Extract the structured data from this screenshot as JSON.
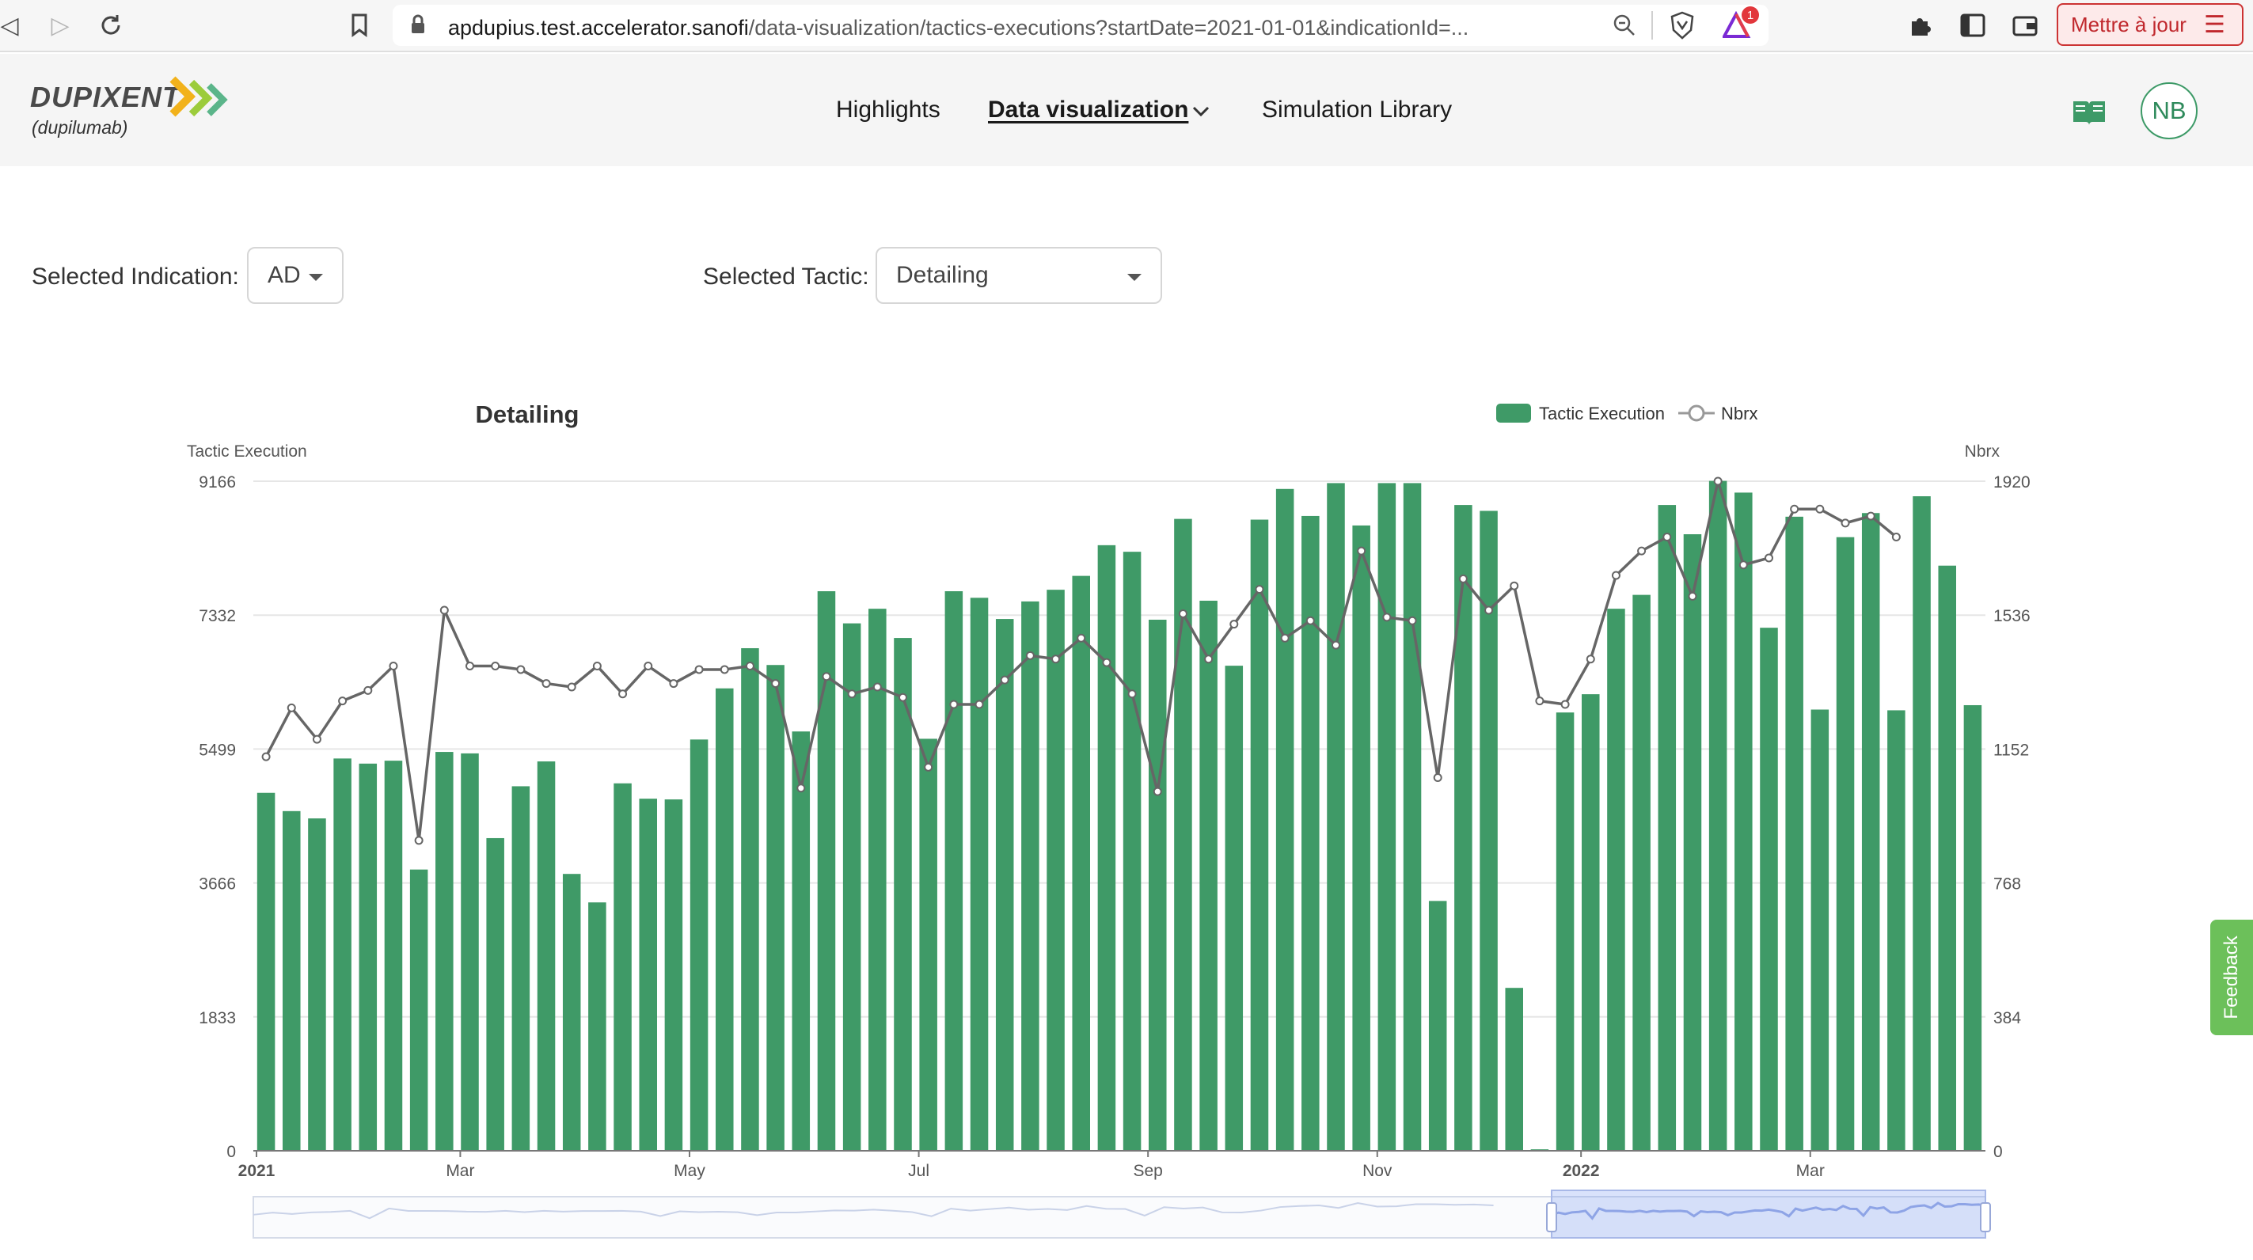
{
  "browser": {
    "url_host": "apdupius.test.accelerator.sanofi",
    "url_path": "/data-visualization/tactics-executions?startDate=2021-01-01&indicationId=...",
    "update_label": "Mettre à jour",
    "badge_count": "1"
  },
  "header": {
    "logo_word": "DUPIXENT",
    "logo_sub": "(dupilumab)",
    "nav": [
      "Highlights",
      "Data visualization",
      "Simulation Library"
    ],
    "avatar": "NB"
  },
  "filters": {
    "indication_label": "Selected Indication:",
    "indication_value": "AD",
    "tactic_label": "Selected Tactic:",
    "tactic_value": "Detailing"
  },
  "feedback_label": "Feedback",
  "colors": {
    "bar": "#3f9a67",
    "line": "#666666",
    "accent": "#2e8a5b"
  },
  "chart_data": {
    "type": "bar",
    "title": "Detailing",
    "ylabel": "Tactic Execution",
    "y2label": "Nbrx",
    "ylim": [
      0,
      9166
    ],
    "y2lim": [
      0,
      1920
    ],
    "yticks": [
      "0",
      "1833",
      "3666",
      "5499",
      "7332",
      "9166"
    ],
    "y2ticks": [
      "0",
      "384",
      "768",
      "1152",
      "1536",
      "1920"
    ],
    "xticks": [
      {
        "label": "2021",
        "index": 0,
        "bold": true
      },
      {
        "label": "Mar",
        "index": 8,
        "bold": false
      },
      {
        "label": "May",
        "index": 17,
        "bold": false
      },
      {
        "label": "Jul",
        "index": 26,
        "bold": false
      },
      {
        "label": "Sep",
        "index": 35,
        "bold": false
      },
      {
        "label": "Nov",
        "index": 44,
        "bold": false
      },
      {
        "label": "2022",
        "index": 52,
        "bold": true
      },
      {
        "label": "Mar",
        "index": 61,
        "bold": false
      }
    ],
    "legend": [
      "Tactic Execution",
      "Nbrx"
    ],
    "legend_position": "top-right",
    "grid": true,
    "series": [
      {
        "name": "Tactic Execution",
        "kind": "bar",
        "axis": "left",
        "values": [
          4900,
          4650,
          4550,
          5370,
          5300,
          5340,
          3850,
          5460,
          5440,
          4280,
          4990,
          5330,
          3790,
          3400,
          5030,
          4820,
          4810,
          5630,
          6330,
          6880,
          6650,
          5740,
          7660,
          7220,
          7420,
          7020,
          5640,
          7660,
          7570,
          7280,
          7520,
          7680,
          7870,
          8290,
          8200,
          7270,
          8650,
          7530,
          6640,
          8640,
          9060,
          8690,
          9140,
          8560,
          9140,
          9140,
          3420,
          8840,
          8760,
          2230,
          20,
          6000,
          6250,
          7420,
          7610,
          8840,
          8440,
          9170,
          9010,
          7160,
          8680,
          6040,
          8400,
          8730,
          6030,
          8960,
          8010,
          6100
        ]
      },
      {
        "name": "Nbrx",
        "kind": "line",
        "axis": "right",
        "values": [
          1130,
          1270,
          1180,
          1290,
          1320,
          1390,
          890,
          1550,
          1390,
          1390,
          1380,
          1340,
          1330,
          1390,
          1310,
          1390,
          1340,
          1380,
          1380,
          1390,
          1340,
          1040,
          1360,
          1310,
          1330,
          1300,
          1100,
          1280,
          1280,
          1350,
          1420,
          1410,
          1470,
          1400,
          1310,
          1030,
          1540,
          1410,
          1510,
          1610,
          1470,
          1520,
          1450,
          1720,
          1530,
          1520,
          1070,
          1640,
          1550,
          1620,
          1290,
          1280,
          1410,
          1650,
          1720,
          1760,
          1590,
          1920,
          1680,
          1700,
          1840,
          1840,
          1800,
          1820,
          1760
        ]
      }
    ]
  }
}
